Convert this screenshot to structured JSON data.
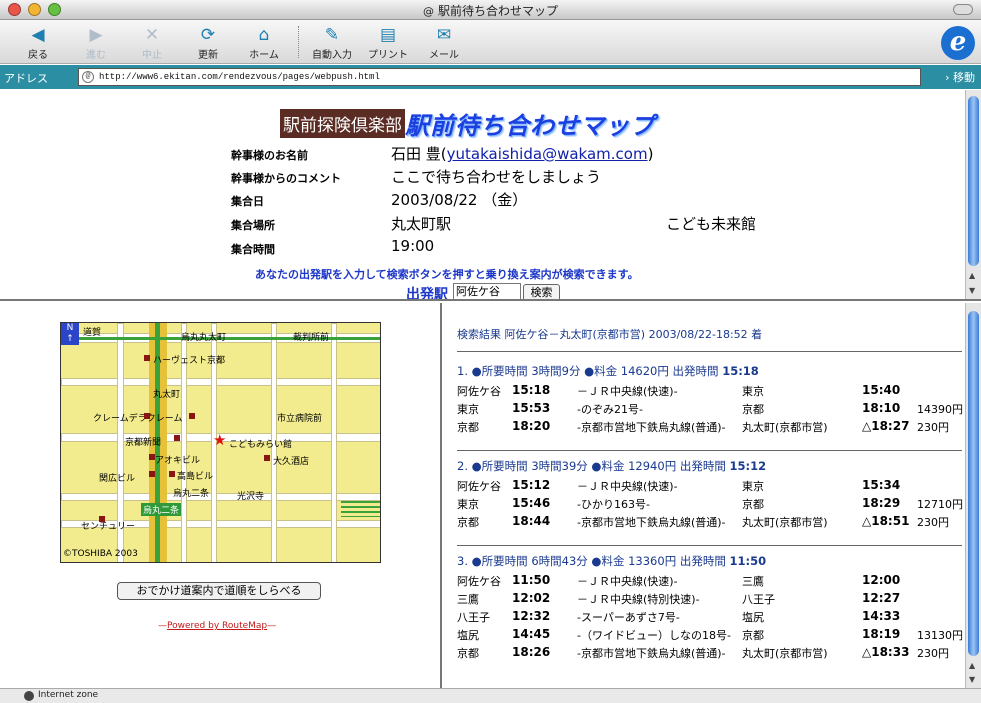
{
  "window": {
    "title": "駅前待ち合わせマップ",
    "title_icon": "@"
  },
  "toolbar": {
    "back": "戻る",
    "forward": "進む",
    "stop": "中止",
    "refresh": "更新",
    "home": "ホーム",
    "autofill": "自動入力",
    "print": "プリント",
    "mail": "メール"
  },
  "addressbar": {
    "label": "アドレス",
    "url": "http://www6.ekitan.com/rendezvous/pages/webpush.html",
    "go": "移動"
  },
  "page": {
    "logo_club": "駅前探険倶楽部",
    "logo_main": "駅前待ち合わせマップ",
    "info": [
      {
        "key": "幹事様のお名前",
        "value": "石田 豊(",
        "email": "yutakaishida@wakam.com",
        "tail": ")"
      },
      {
        "key": "幹事様からのコメント",
        "value": "ここで待ち合わせをしましょう"
      },
      {
        "key": "集合日",
        "value": "2003/08/22 （金）"
      },
      {
        "key": "集合場所",
        "value": "丸太町駅",
        "value2": "こども未来館"
      },
      {
        "key": "集合時間",
        "value": "19:00"
      }
    ],
    "prompt": "あなたの出発駅を入力して検索ボタンを押すと乗り換え案内が検索できます。",
    "depart_label": "出発駅",
    "depart_value": "阿佐ケ谷",
    "search_button": "検索"
  },
  "map": {
    "labels": {
      "dosho": "道賀",
      "karasuma_oike": "烏丸丸太町",
      "court": "裁判所前",
      "harvest": "ハーヴェスト京都",
      "marutamachi": "丸太町",
      "cafe": "クレームデラクレーム",
      "cityhall": "市立病院前",
      "kyoto_np": "京都新聞",
      "star_label": "こどもみらい館",
      "aoki": "アオキビル",
      "okubo": "大久酒店",
      "kanbiro": "関広ビル",
      "takashima": "高島ビル",
      "karasuma2": "烏丸二条",
      "kosho": "光沢寺",
      "station_tag": "烏丸二条",
      "century": "センチュリー",
      "copyright": "©TOSHIBA 2003"
    }
  },
  "route_button": "おでかけ道案内で道順をしらべる",
  "powered": {
    "prefix": "—",
    "link": "Powered by RouteMap",
    "suffix": "—"
  },
  "results": {
    "header": "検索結果 阿佐ケ谷－丸太町(京都市営) 2003/08/22-18:52 着",
    "routes": [
      {
        "title": "1. ●所要時間 3時間9分 ●料金 14620円 出発時間 ",
        "depart": "15:18",
        "legs": [
          {
            "from": "阿佐ケ谷",
            "dep": "15:18",
            "line": "－ＪＲ中央線(快速)-",
            "to": "東京",
            "arr": "15:40",
            "fare": ""
          },
          {
            "from": "東京",
            "dep": "15:53",
            "line": "-のぞみ21号-",
            "to": "京都",
            "arr": "18:10",
            "fare": "14390円"
          },
          {
            "from": "京都",
            "dep": "18:20",
            "line": "-京都市営地下鉄烏丸線(普通)-",
            "to": "丸太町(京都市営)",
            "arr": "△18:27",
            "fare": "230円"
          }
        ]
      },
      {
        "title": "2. ●所要時間 3時間39分 ●料金 12940円 出発時間 ",
        "depart": "15:12",
        "legs": [
          {
            "from": "阿佐ケ谷",
            "dep": "15:12",
            "line": "－ＪＲ中央線(快速)-",
            "to": "東京",
            "arr": "15:34",
            "fare": ""
          },
          {
            "from": "東京",
            "dep": "15:46",
            "line": "-ひかり163号-",
            "to": "京都",
            "arr": "18:29",
            "fare": "12710円"
          },
          {
            "from": "京都",
            "dep": "18:44",
            "line": "-京都市営地下鉄烏丸線(普通)-",
            "to": "丸太町(京都市営)",
            "arr": "△18:51",
            "fare": "230円"
          }
        ]
      },
      {
        "title": "3. ●所要時間 6時間43分 ●料金 13360円 出発時間 ",
        "depart": "11:50",
        "legs": [
          {
            "from": "阿佐ケ谷",
            "dep": "11:50",
            "line": "－ＪＲ中央線(快速)-",
            "to": "三鷹",
            "arr": "12:00",
            "fare": ""
          },
          {
            "from": "三鷹",
            "dep": "12:02",
            "line": "－ＪＲ中央線(特別快速)-",
            "to": "八王子",
            "arr": "12:27",
            "fare": ""
          },
          {
            "from": "八王子",
            "dep": "12:32",
            "line": "-スーパーあずさ7号-",
            "to": "塩尻",
            "arr": "14:33",
            "fare": ""
          },
          {
            "from": "塩尻",
            "dep": "14:45",
            "line": "-（ワイドビュー）しなの18号-",
            "to": "京都",
            "arr": "18:19",
            "fare": "13130円"
          },
          {
            "from": "京都",
            "dep": "18:26",
            "line": "-京都市営地下鉄烏丸線(普通)-",
            "to": "丸太町(京都市営)",
            "arr": "△18:33",
            "fare": "230円"
          }
        ]
      }
    ]
  },
  "status": {
    "text": "Internet zone"
  },
  "colors": {
    "accent_blue": "#1d37c8",
    "link_blue": "#1a3a8f",
    "addressbar": "#2c8ea3",
    "map_bg": "#f2ec8e"
  }
}
